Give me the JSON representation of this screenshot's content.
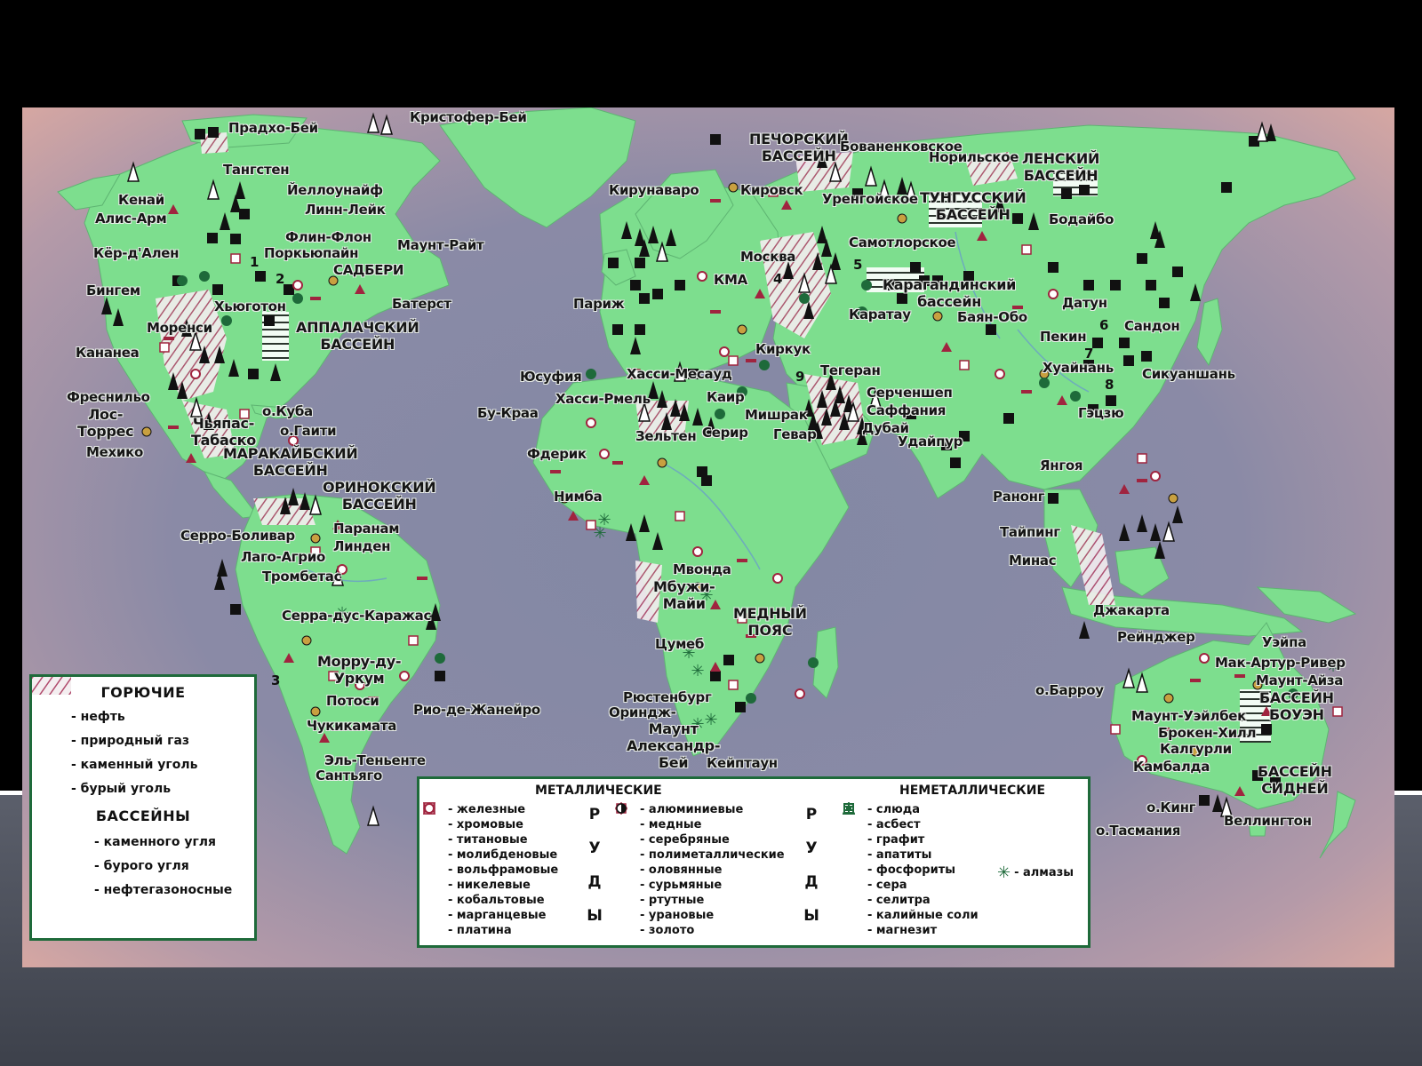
{
  "labels": {
    "prudhoe": "Прадхо-Бей",
    "christopher": "Кристофер-Бей",
    "tungsten": "Тангстен",
    "kenai": "Кенай",
    "yellowknife": "Йеллоунайф",
    "alice_arm": "Алис-Арм",
    "lynn_lake": "Линн-Лейк",
    "flin_flon": "Флин-Флон",
    "porcupine": "Поркьюпайн",
    "mount_wright": "Маунт-Райт",
    "coeur": "Кёр-д'Ален",
    "sudbury": "САДБЕРИ",
    "bingham": "Бингем",
    "bathurst": "Батерст",
    "hewitt": "Хьюготон",
    "morenci": "Моренси",
    "appalachian": "АППАЛАЧСКИЙ\nБАССЕЙН",
    "canonea": "Кананеа",
    "cuba": "о.Куба",
    "fresnillo": "Фреснильо",
    "los_torres": "Лос-\nТоррес",
    "mexico": "Мехико",
    "chiapas": "Чьяпас-\nТабаско",
    "haiti": "о.Гаити",
    "maracaibo": "МАРАКАЙБСКИЙ\nБАССЕЙН",
    "orinoco": "ОРИНОКСКИЙ\nБАССЕЙН",
    "cerro_bolivar": "Серро-Боливар",
    "paranam": "Паранам",
    "lago_agrio": "Лаго-Агрио",
    "linden": "Линден",
    "trombetas": "Тромбетас",
    "serra": "Серра-дус-Каражас",
    "morro": "Морру-ду-\nУркум",
    "potosi": "Потоси",
    "rio": "Рио-де-Жанейро",
    "chuquicamata": "Чукикамата",
    "el_teniente": "Эль-Теньенте",
    "santiago": "Сантьяго",
    "kiruna": "Кирунаваро",
    "kirovsk": "Кировск",
    "pechora": "ПЕЧОРСКИЙ\nБАССЕЙН",
    "bovanenkovo": "Бованенковское",
    "norilsk": "Норильское",
    "lena": "ЛЕНСКИЙ\nБАССЕЙН",
    "tunguska": "ТУНГУССКИЙ\nБАССЕЙН",
    "urengoy": "Уренгойское",
    "bodaibo": "Бодайбо",
    "samotlor": "Самотлорское",
    "moscow": "Москва",
    "kma": "КМА",
    "karaganda": "Карагандинский\nбассейн",
    "paris": "Париж",
    "karatau": "Каратау",
    "bayan_obo": "Баян-Обо",
    "datong": "Датун",
    "sandong": "Сандон",
    "beijing": "Пекин",
    "kirkuk": "Киркук",
    "yusufia": "Юсуфия",
    "hassi_messaoud": "Хасси-Месауд",
    "hassi_rmel": "Хасси-Рмель",
    "bu_craa": "Бу-Краа",
    "cairo": "Каир",
    "tehran": "Тегеран",
    "serchenshe": "Серченшеп",
    "safaniya": "Саффания",
    "mishrak": "Мишрак",
    "gavar": "Гевар",
    "zelten": "Зельтен",
    "serir": "Серир",
    "dubai": "Дубай",
    "udaipur": "Удайпур",
    "huainan": "Хуайнань",
    "sikuanshan": "Сикуаншань",
    "gejiu": "Гэцзю",
    "derik": "Фдерик",
    "nimba": "Нимба",
    "yangoy": "Янгоя",
    "ranong": "Ранонг",
    "taiping": "Тайпинг",
    "mwanda": "Мвонда",
    "mbuji": "Мбужи-\nМайи",
    "copper": "МЕДНЫЙ\nПОЯС",
    "minas": "Минас",
    "jakarta": "Джакарта",
    "tsumeb": "Цумеб",
    "ranger": "Рейнджер",
    "weipa": "Уэйпа",
    "mcarthur": "Мак-Артур-Ривер",
    "mount_isa": "Маунт-Айза",
    "bowen": "БАССЕЙН\nБОУЭН",
    "rustenburg": "Рюстенбург",
    "orange": "Ориндж-",
    "mount_alex": "Маунт\nАлександр-\nБей",
    "capetown": "Кейптаун",
    "barrow": "о.Барроу",
    "mount_whaleback": "Маунт-Уэйлбек",
    "broken_hill": "Брокен-Хилл",
    "kalgoorlie": "Калгурли",
    "kambalda": "Камбалда",
    "sydney": "БАССЕЙН\nСИДНЕЙ",
    "king": "о.Кинг",
    "tasmania": "о.Тасмания",
    "wellington": "Веллингтон"
  },
  "numbers": [
    "1",
    "2",
    "3",
    "4",
    "5",
    "6",
    "7",
    "8",
    "9"
  ],
  "legend_fuel": {
    "title": "ГОРЮЧИЕ",
    "items": [
      "- нефть",
      "- природный газ",
      "- каменный уголь",
      "- бурый уголь"
    ],
    "basins_title": "БАССЕЙНЫ",
    "basins": [
      "- каменного угля",
      "- бурого угля",
      "- нефтегазоносные"
    ]
  },
  "legend_ores": {
    "metallic_title": "МЕТАЛЛИЧЕСКИЕ",
    "nonmetallic_title": "НЕМЕТАЛЛИЧЕСКИЕ",
    "ores_word": [
      "Р",
      "У",
      "Д",
      "Ы"
    ],
    "col1": [
      "- железные",
      "- хромовые",
      "- титановые",
      "- молибденовые",
      "- вольфрамовые",
      "- никелевые",
      "- кобальтовые",
      "- марганцевые",
      "- платина"
    ],
    "col2": [
      "- алюминиевые",
      "- медные",
      "- серебряные",
      "- полиметаллические",
      "- оловянные",
      "- сурьмяные",
      "- ртутные",
      "- урановые",
      "- золото"
    ],
    "col3": [
      "- слюда",
      "- асбест",
      "- графит",
      "- апатиты",
      "- фосфориты",
      "- сера",
      "- селитра",
      "- калийные соли",
      "- магнезит"
    ],
    "diamonds": "- алмазы"
  },
  "colors": {
    "land": "#7dde8e",
    "sea": "#8a8aa8",
    "frame": "#1e6a3a",
    "symbol_red": "#a0243f",
    "symbol_dark": "#111111"
  }
}
